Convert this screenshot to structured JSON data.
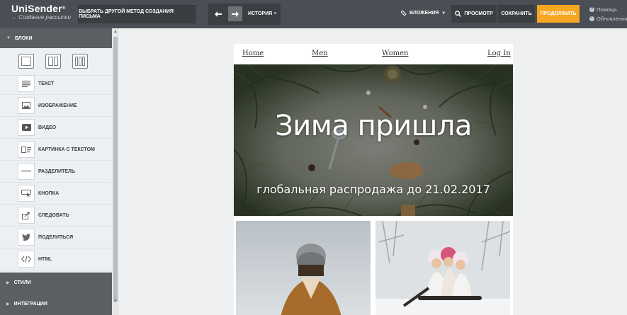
{
  "app": {
    "brand": "UniSender",
    "reg_mark": "®",
    "subtitle": "← Создание рассылки"
  },
  "toolbar": {
    "change_method_label": "Выбрать другой метод создания письма",
    "history_label": "История",
    "attachments_label": "Вложения",
    "preview_label": "Просмотр",
    "save_label": "Сохранить",
    "continue_label": "Продолжить",
    "help_label": "Помощь",
    "updates_label": "Обновления"
  },
  "sidebar": {
    "blocks_label": "Блоки",
    "column_layouts": [
      "1 column",
      "2 columns",
      "3 columns"
    ],
    "items": [
      {
        "label": "Текст",
        "icon": "text-icon"
      },
      {
        "label": "Изображение",
        "icon": "image-icon"
      },
      {
        "label": "Видео",
        "icon": "video-icon"
      },
      {
        "label": "Картинка с текстом",
        "icon": "image-text-icon"
      },
      {
        "label": "Разделитель",
        "icon": "divider-icon"
      },
      {
        "label": "Кнопка",
        "icon": "button-icon"
      },
      {
        "label": "Следовать",
        "icon": "follow-icon"
      },
      {
        "label": "Поделиться",
        "icon": "twitter-icon"
      },
      {
        "label": "HTML",
        "icon": "code-icon"
      }
    ],
    "styles_label": "Стили",
    "integrations_label": "Интеграции"
  },
  "email": {
    "nav": [
      "Home",
      "Men",
      "Women",
      "Log In"
    ],
    "hero_title": "Зима пришла",
    "hero_subtitle": "глобальная распродажа до 21.02.2017"
  },
  "colors": {
    "topbar": "#4a4f55",
    "accent_orange": "#f6a623",
    "sidebar_bg": "#edf0f2",
    "section_header": "#5b5f64",
    "canvas_bg": "#eef0f2"
  }
}
